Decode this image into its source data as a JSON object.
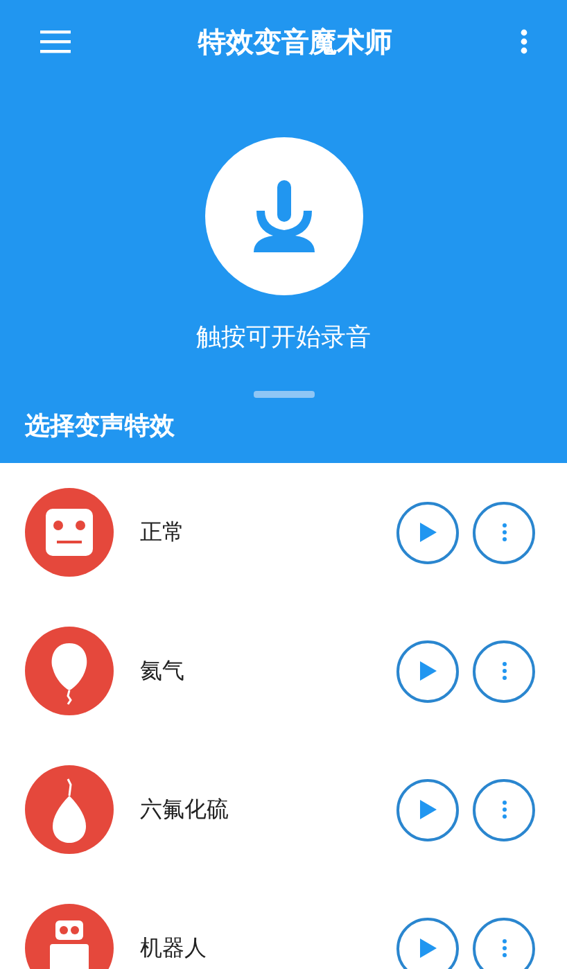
{
  "app_bar": {
    "title": "特效变音魔术师"
  },
  "record": {
    "hint": "触按可开始录音"
  },
  "section_title": "选择变声特效",
  "effects": [
    {
      "name": "正常",
      "kind": "face"
    },
    {
      "name": "氦气",
      "kind": "balloon"
    },
    {
      "name": "六氟化硫",
      "kind": "drop"
    },
    {
      "name": "机器人",
      "kind": "robot"
    }
  ]
}
